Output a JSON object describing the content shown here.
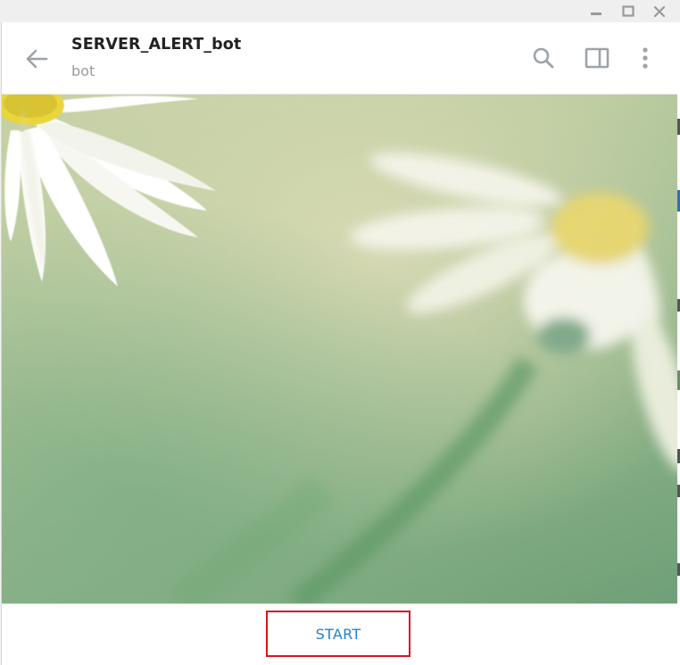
{
  "os_window": {
    "controls": {
      "minimize": "minimize-icon",
      "maximize": "maximize-icon",
      "close": "close-icon"
    }
  },
  "chat": {
    "title": "SERVER_ALERT_bot",
    "status": "bot"
  },
  "header_actions": {
    "back": "arrow-left-icon",
    "search": "search-icon",
    "sidebar": "sidebar-toggle-icon",
    "menu": "more-vertical-icon"
  },
  "bottom_bar": {
    "start_label": "START"
  },
  "colors": {
    "accent": "#2481cc",
    "highlight": "#d9141a",
    "icon": "#9ea3a8",
    "title": "#222222",
    "status": "#9a9a9a"
  }
}
